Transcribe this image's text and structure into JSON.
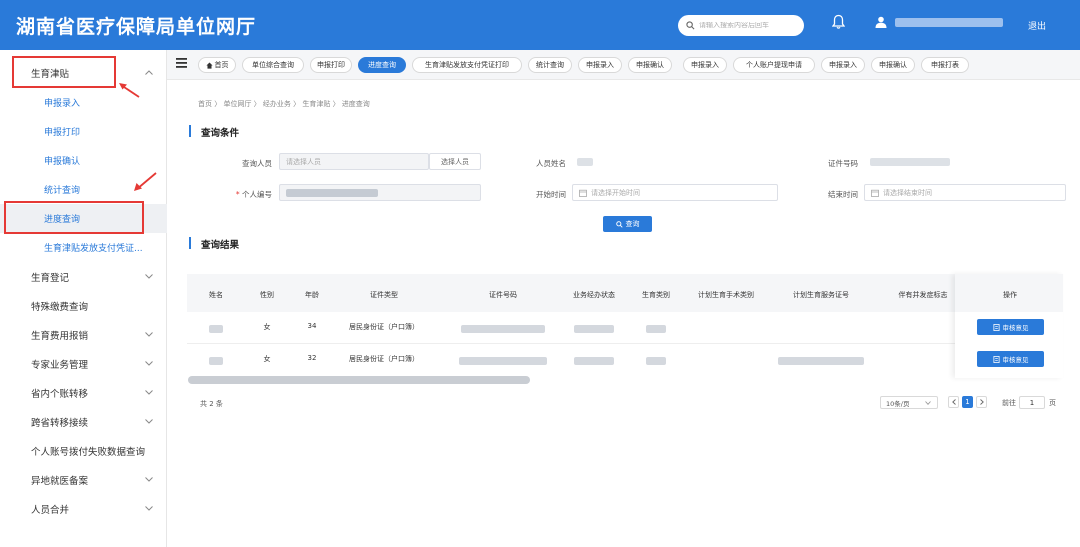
{
  "header": {
    "title": "湖南省医疗保障局单位网厅",
    "search_placeholder": "请输入搜索内容后回车",
    "logout": "退出"
  },
  "sidebar": {
    "items": [
      {
        "label": "生育津贴",
        "type": "top",
        "expanded": true
      },
      {
        "label": "申报录入",
        "type": "sub"
      },
      {
        "label": "申报打印",
        "type": "sub"
      },
      {
        "label": "申报确认",
        "type": "sub"
      },
      {
        "label": "统计查询",
        "type": "sub"
      },
      {
        "label": "进度查询",
        "type": "sub",
        "active": true
      },
      {
        "label": "生育津贴发放支付凭证...",
        "type": "sub"
      },
      {
        "label": "生育登记",
        "type": "top"
      },
      {
        "label": "特殊缴费查询",
        "type": "top"
      },
      {
        "label": "生育费用报销",
        "type": "top"
      },
      {
        "label": "专家业务管理",
        "type": "top"
      },
      {
        "label": "省内个账转移",
        "type": "top"
      },
      {
        "label": "跨省转移接续",
        "type": "top"
      },
      {
        "label": "个人账号拨付失败数据查询",
        "type": "top"
      },
      {
        "label": "异地就医备案",
        "type": "top"
      },
      {
        "label": "人员合并",
        "type": "top"
      }
    ]
  },
  "tabs": [
    "首页",
    "单位综合查询",
    "申报打印",
    "进度查询",
    "生育津贴发放支付凭证打印",
    "统计查询",
    "申报录入",
    "申报确认",
    "申报录入",
    "个人账户提现申请",
    "申报录入",
    "申报确认",
    "申报打表"
  ],
  "breadcrumb": "首页 〉 单位网厅 〉 经办业务 〉 生育津贴 〉 进度查询",
  "query": {
    "title": "查询条件",
    "person_label": "查询人员",
    "person_placeholder": "请选择人员",
    "select_person_btn": "选择人员",
    "name_label": "人员姓名",
    "id_label": "证件号码",
    "pid_label": "个人编号",
    "start_label": "开始时间",
    "start_placeholder": "请选择开始时间",
    "end_label": "结束时间",
    "end_placeholder": "请选择结束时间",
    "query_btn": "查询"
  },
  "results": {
    "title": "查询结果",
    "columns": [
      "姓名",
      "性别",
      "年龄",
      "证件类型",
      "证件号码",
      "业务经办状态",
      "生育类别",
      "计划生育手术类别",
      "计划生育服务证号",
      "伴有并发症标志",
      "操作"
    ],
    "rows": [
      {
        "gender": "女",
        "age": "34",
        "id_type": "居民身份证（户口簿）",
        "action": "审核意见"
      },
      {
        "gender": "女",
        "age": "32",
        "id_type": "居民身份证（户口簿）",
        "action": "审核意见"
      }
    ],
    "total": "共 2 条"
  },
  "pagination": {
    "page_size": "10条/页",
    "current": "1",
    "goto_label": "前往",
    "goto_value": "1",
    "page_suffix": "页"
  }
}
